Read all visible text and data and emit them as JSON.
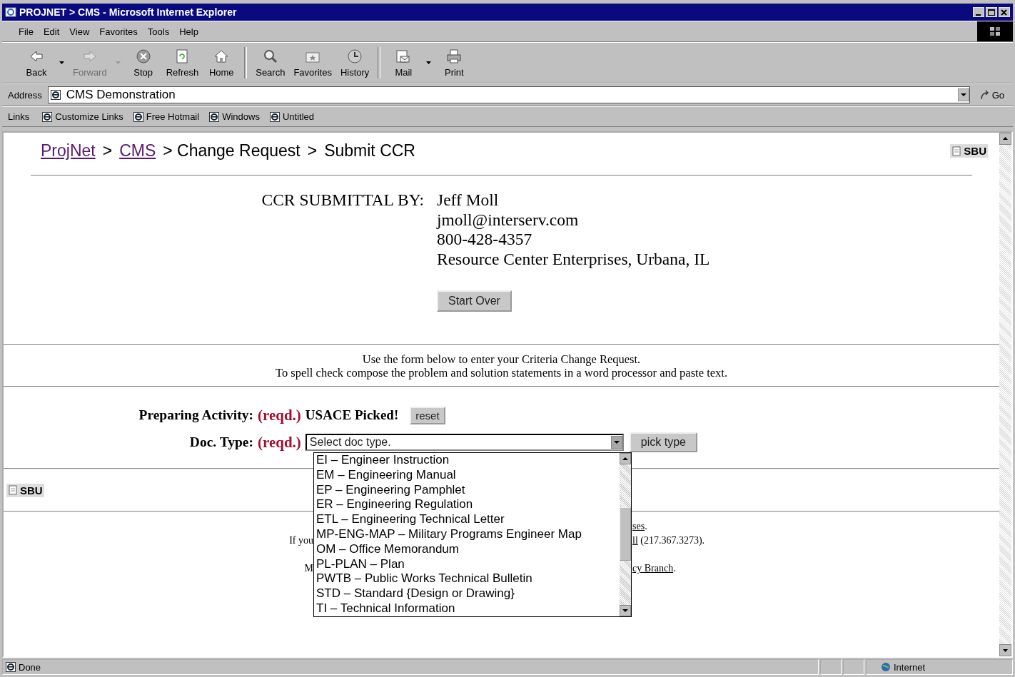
{
  "window": {
    "title": "PROJNET > CMS - Microsoft Internet Explorer"
  },
  "menu": [
    "File",
    "Edit",
    "View",
    "Favorites",
    "Tools",
    "Help"
  ],
  "toolbar": [
    {
      "label": "Back",
      "kind": "back",
      "disabled": false,
      "has_menu": true
    },
    {
      "label": "Forward",
      "kind": "forward",
      "disabled": true,
      "has_menu": true
    },
    {
      "label": "Stop",
      "kind": "stop",
      "disabled": false,
      "has_menu": false
    },
    {
      "label": "Refresh",
      "kind": "refresh",
      "disabled": false,
      "has_menu": false
    },
    {
      "label": "Home",
      "kind": "home",
      "disabled": false,
      "has_menu": false
    },
    {
      "label": "Search",
      "kind": "search",
      "disabled": false,
      "has_menu": false
    },
    {
      "label": "Favorites",
      "kind": "favorites",
      "disabled": false,
      "has_menu": false
    },
    {
      "label": "History",
      "kind": "history",
      "disabled": false,
      "has_menu": false
    },
    {
      "label": "Mail",
      "kind": "mail",
      "disabled": false,
      "has_menu": true
    },
    {
      "label": "Print",
      "kind": "print",
      "disabled": false,
      "has_menu": false
    }
  ],
  "address": {
    "label": "Address",
    "value": "CMS Demonstration",
    "go": "Go"
  },
  "links": {
    "label": "Links",
    "items": [
      "Customize Links",
      "Free Hotmail",
      "Windows",
      "Untitled"
    ]
  },
  "page": {
    "breadcrumb": [
      {
        "text": "ProjNet",
        "link": true
      },
      {
        "text": ">",
        "link": false
      },
      {
        "text": "CMS",
        "link": true
      },
      {
        "text": "> Change Request",
        "link": false
      },
      {
        "text": ">",
        "link": false
      },
      {
        "text": "Submit CCR",
        "link": false
      }
    ],
    "sbu": "SBU",
    "submittal": {
      "label": "CCR SUBMITTAL BY:",
      "lines": [
        "Jeff Moll",
        "jmoll@interserv.com",
        "800-428-4357",
        "Resource Center Enterprises, Urbana, IL"
      ],
      "button": "Start Over"
    },
    "instructions": [
      "Use the form below to enter your Criteria Change Request.",
      "To spell check compose the problem and solution statements in a word processor and paste text."
    ],
    "preparing": {
      "label": "Preparing Activity:",
      "required": "(reqd.)",
      "value": "USACE Picked!",
      "button": "reset"
    },
    "doc_type": {
      "label": "Doc. Type:",
      "required": "(reqd.)",
      "placeholder": "Select doc type.",
      "button": "pick type",
      "expanded": true,
      "options": [
        "EI – Engineer Instruction",
        "EM – Engineering Manual",
        "EP – Engineering Pamphlet",
        "ER – Engineering Regulation",
        "ETL – Engineering Technical Letter",
        "MP-ENG-MAP – Military Programs Engineer Map",
        "OM – Office Memorandum",
        "PL-PLAN – Plan",
        "PWTB – Public Works Technical Bulletin",
        "STD – Standard {Design or Drawing}",
        "TI – Technical Information"
      ]
    },
    "sbu_bottom": "SBU",
    "footer": [
      {
        "link": "ses",
        "after": "."
      },
      {
        "left": "If you",
        "link": "ll",
        "after": " (217.367.3273)."
      },
      {
        "left": "M",
        "link": "cy Branch",
        "after": "."
      }
    ]
  },
  "status_bar": {
    "text": "Done",
    "zone": "Internet"
  }
}
